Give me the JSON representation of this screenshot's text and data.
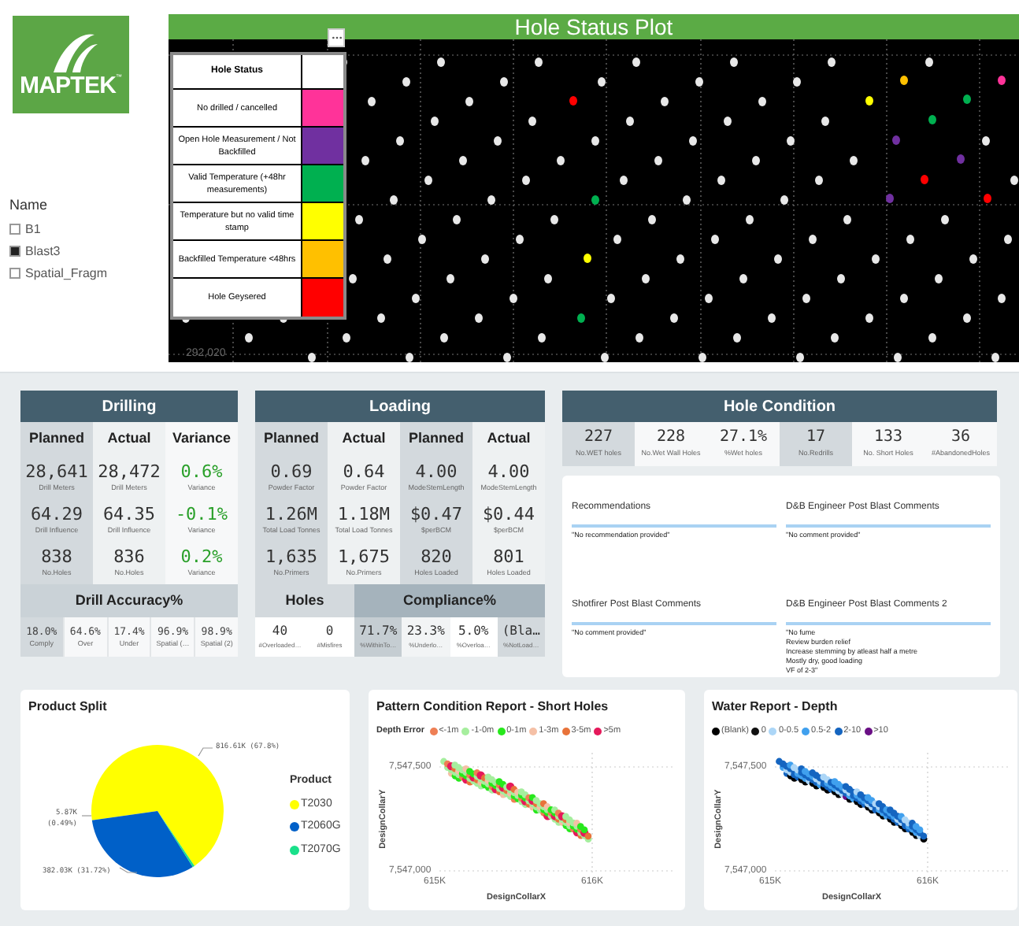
{
  "logo": {
    "text": "MAPTEK",
    "mark": "™"
  },
  "slicer": {
    "title": "Name",
    "items": [
      {
        "label": "B1",
        "selected": false
      },
      {
        "label": "Blast3",
        "selected": true
      },
      {
        "label": "Spatial_Fragm",
        "selected": false
      }
    ]
  },
  "hole_status_plot": {
    "title": "Hole Status Plot",
    "y_tick": "292,020",
    "legend": {
      "title": "Hole Status",
      "items": [
        {
          "label": "No drilled / cancelled",
          "color": "#ff3399"
        },
        {
          "label": "Open Hole Measurement / Not Backfilled",
          "color": "#7030a0"
        },
        {
          "label": "Valid Temperature (+48hr measurements)",
          "color": "#00b050"
        },
        {
          "label": "Temperature but no valid time stamp",
          "color": "#ffff00"
        },
        {
          "label": "Backfilled Temperature <48hrs",
          "color": "#ffc000"
        },
        {
          "label": "Hole Geysered",
          "color": "#ff0000"
        }
      ]
    }
  },
  "drilling": {
    "title": "Drilling",
    "columns": [
      {
        "kind": "planned",
        "header": "Planned",
        "cells": [
          {
            "value": "28,641",
            "label": "Drill Meters"
          },
          {
            "value": "64.29",
            "label": "Drill Influence"
          },
          {
            "value": "838",
            "label": "No.Holes"
          }
        ]
      },
      {
        "kind": "actual",
        "header": "Actual",
        "cells": [
          {
            "value": "28,472",
            "label": "Drill Meters"
          },
          {
            "value": "64.35",
            "label": "Drill Influence"
          },
          {
            "value": "836",
            "label": "No.Holes"
          }
        ]
      },
      {
        "kind": "variance",
        "header": "Variance",
        "cells": [
          {
            "value": "0.6%",
            "label": "Variance"
          },
          {
            "value": "-0.1%",
            "label": "Variance"
          },
          {
            "value": "0.2%",
            "label": "Variance"
          }
        ]
      }
    ],
    "accuracy": {
      "title": "Drill Accuracy%",
      "cells": [
        {
          "value": "18.0%",
          "label": "Comply"
        },
        {
          "value": "64.6%",
          "label": "Over"
        },
        {
          "value": "17.4%",
          "label": "Under"
        },
        {
          "value": "96.9%",
          "label": "Spatial (…"
        },
        {
          "value": "98.9%",
          "label": "Spatial (2)"
        }
      ]
    }
  },
  "loading": {
    "title": "Loading",
    "columns": [
      {
        "kind": "planned",
        "header": "Planned",
        "cells": [
          {
            "value": "0.69",
            "label": "Powder Factor"
          },
          {
            "value": "1.26M",
            "label": "Total Load Tonnes"
          },
          {
            "value": "1,635",
            "label": "No.Primers"
          }
        ]
      },
      {
        "kind": "actual",
        "header": "Actual",
        "cells": [
          {
            "value": "0.64",
            "label": "Powder Factor"
          },
          {
            "value": "1.18M",
            "label": "Total Load Tonnes"
          },
          {
            "value": "1,675",
            "label": "No.Primers"
          }
        ]
      },
      {
        "kind": "planned",
        "header": "Planned",
        "cells": [
          {
            "value": "4.00",
            "label": "ModeStemLength"
          },
          {
            "value": "$0.47",
            "label": "$perBCM"
          },
          {
            "value": "820",
            "label": "Holes Loaded"
          }
        ]
      },
      {
        "kind": "actual",
        "header": "Actual",
        "cells": [
          {
            "value": "4.00",
            "label": "ModeStemLength"
          },
          {
            "value": "$0.44",
            "label": "$perBCM"
          },
          {
            "value": "801",
            "label": "Holes Loaded"
          }
        ]
      }
    ],
    "groups": [
      {
        "title": "Holes",
        "cells": [
          {
            "value": "40",
            "label": "#Overloaded…"
          },
          {
            "value": "0",
            "label": "#Misfires"
          }
        ]
      },
      {
        "title": "Compliance%",
        "cells": [
          {
            "value": "71.7%",
            "label": "%WithinTo…"
          },
          {
            "value": "23.3%",
            "label": "%Underlo…"
          },
          {
            "value": "5.0%",
            "label": "%Overloa…"
          },
          {
            "value": "(Bla…",
            "label": "%NotLoad…"
          }
        ]
      }
    ]
  },
  "hole_condition": {
    "title": "Hole Condition",
    "cells": [
      {
        "value": "227",
        "label": "No.WET holes"
      },
      {
        "value": "228",
        "label": "No.Wet Wall Holes"
      },
      {
        "value": "27.1%",
        "label": "%Wet holes"
      },
      {
        "value": "17",
        "label": "No.Redrills"
      },
      {
        "value": "133",
        "label": "No. Short Holes"
      },
      {
        "value": "36",
        "label": "#AbandonedHoles"
      }
    ]
  },
  "comments": [
    {
      "title": "Recommendations",
      "lines": [
        "\"No recommendation provided\""
      ]
    },
    {
      "title": "D&B Engineer Post Blast Comments",
      "lines": [
        "\"No comment provided\""
      ]
    },
    {
      "title": "Shotfirer Post Blast Comments",
      "lines": [
        "\"No comment provided\""
      ]
    },
    {
      "title": "D&B Engineer Post Blast Comments 2",
      "lines": [
        "\"No fume",
        "Review burden relief",
        "Increase stemming by atleast half a metre",
        "Mostly dry, good loading",
        "VF of 2-3\""
      ]
    }
  ],
  "product_split": {
    "title": "Product Split",
    "chart_data": {
      "type": "pie",
      "legend": true,
      "categories": [
        "T2030",
        "T2060G",
        "T2070G"
      ],
      "series": [
        {
          "name": "Product",
          "values": [
            67.8,
            31.72,
            0.49
          ]
        }
      ],
      "colors": [
        "#ffff00",
        "#0060c8",
        "#19e08a"
      ],
      "value_labels": [
        "816.61K (67.8%)",
        "382.03K (31.72%)",
        "5.87K (0.49%)"
      ]
    }
  },
  "pattern_report": {
    "title": "Pattern Condition Report - Short Holes",
    "legend_title": "Depth Error",
    "legend": [
      {
        "label": "<-1m",
        "color": "#ee7f55"
      },
      {
        "label": "-1-0m",
        "color": "#a6ee9e"
      },
      {
        "label": "0-1m",
        "color": "#27e81c"
      },
      {
        "label": "1-3m",
        "color": "#f5c0a6"
      },
      {
        "label": "3-5m",
        "color": "#e8733a"
      },
      {
        "label": ">5m",
        "color": "#e5195b"
      }
    ],
    "y_ticks": [
      "7,547,500",
      "7,547,000"
    ],
    "x_ticks": [
      "615K",
      "616K"
    ],
    "ylabel": "DesignCollarY",
    "xlabel": "DesignCollarX"
  },
  "water_report": {
    "title": "Water Report - Depth",
    "legend": [
      {
        "label": "(Blank)",
        "color": "#000000"
      },
      {
        "label": "0",
        "color": "#111111"
      },
      {
        "label": "0-0.5",
        "color": "#acd6f7"
      },
      {
        "label": "0.5-2",
        "color": "#40a0ee"
      },
      {
        "label": "2-10",
        "color": "#1565c0"
      },
      {
        "label": ">10",
        "color": "#6a0f85"
      }
    ],
    "y_ticks": [
      "7,547,500",
      "7,547,000"
    ],
    "x_ticks": [
      "615K",
      "616K"
    ],
    "ylabel": "DesignCollarY",
    "xlabel": "DesignCollarX"
  }
}
